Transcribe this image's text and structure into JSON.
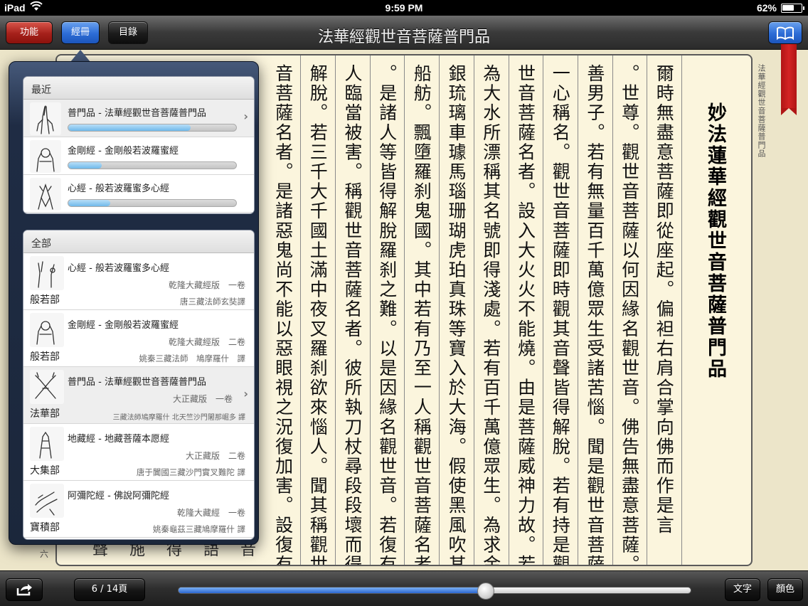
{
  "status_bar": {
    "carrier": "iPad",
    "time": "9:59 PM",
    "battery": "62%",
    "battery_level": 0.62
  },
  "toolbar": {
    "function_label": "功能",
    "sutra_label": "經冊",
    "toc_label": "目錄",
    "title": "法華經觀世音菩薩普門品",
    "bookmark_icon": "open-book-icon"
  },
  "page": {
    "side_label": "法華經觀世音菩薩普門品",
    "heading": "妙法蓮華經觀世音菩薩普門品",
    "columns": [
      "爾時無盡意菩薩即從座起。偏袒右肩合掌向佛而作是言",
      "。世尊。觀世音菩薩以何因緣名觀世音。佛告無盡意菩薩。",
      "善男子。若有無量百千萬億眾生受諸苦惱。聞是觀世音菩薩",
      "一心稱名。觀世音菩薩即時觀其音聲皆得解脫。若有持是觀",
      "世音菩薩名者。設入大火火不能燒。由是菩薩威神力故。若",
      "為大水所漂稱其名號即得淺處。若有百千萬億眾生。為求金",
      "銀琉璃車璩馬瑙珊瑚虎珀真珠等寶入於大海。假使黑風吹其",
      "船舫。飄墮羅刹鬼國。其中若有乃至一人稱觀世音菩薩名者",
      "。是諸人等皆得解脫羅刹之難。以是因緣名觀世音。若復有",
      "人臨當被害。稱觀世音菩薩名者。彼所執刀杖尋段段壞而得",
      "解脫。若三千大千國土滿中夜叉羅刹欲來惱人。聞其稱觀世",
      "音菩薩名者。是諸惡鬼尚不能以惡眼視之況復加害。設復有"
    ],
    "peek_chars": [
      "聲",
      "施",
      "得",
      "語",
      "音"
    ],
    "peek_number": "六"
  },
  "popover": {
    "recent_header": "最近",
    "recent": [
      {
        "title": "普門品 - 法華經觀世音菩薩普門品",
        "progress": 0.73,
        "thumb": "praying-hands-icon"
      },
      {
        "title": "金剛經 - 金剛般若波羅蜜經",
        "progress": 0.2,
        "thumb": "mudra-hands-icon"
      },
      {
        "title": "心經 - 般若波羅蜜多心經",
        "progress": 0.25,
        "thumb": "lotus-hands-icon"
      }
    ],
    "all_header": "全部",
    "all": [
      {
        "title": "心經 - 般若波羅蜜多心經",
        "category": "般若部",
        "edition": "乾隆大藏經版　一卷",
        "translator": "唐三藏法師玄奘譯",
        "thumb": "teaching-hands-icon"
      },
      {
        "title": "金剛經 - 金剛般若波羅蜜經",
        "category": "般若部",
        "edition": "乾隆大藏經版　二卷",
        "translator": "姚秦三藏法師　鳩摩羅什　譯",
        "thumb": "mudra-hands-icon"
      },
      {
        "title": "普門品 - 法華經觀世音菩薩普門品",
        "category": "法華部",
        "edition": "大正藏版　一卷",
        "translator": "三藏法師鳩摩羅什 北天竺沙門闍那崛多 譯",
        "thumb": "crossed-hands-icon"
      },
      {
        "title": "地藏經 - 地藏菩薩本愿經",
        "category": "大集部",
        "edition": "大正藏版　二卷",
        "translator": "唐于闐國三藏沙門實叉難陀 譯",
        "thumb": "joined-hands-icon"
      },
      {
        "title": "阿彌陀經 - 佛說阿彌陀經",
        "category": "寶積部",
        "edition": "乾隆大藏經　一卷",
        "translator": "姚秦龜茲三藏鳩摩羅什 譯",
        "thumb": "offering-hands-icon"
      }
    ]
  },
  "bottom_bar": {
    "share_icon": "share-icon",
    "page_indicator": "6 / 14頁",
    "slider_value": 0.6,
    "text_label": "文字",
    "color_label": "顏色"
  },
  "colors": {
    "accent_blue": "#2c6cd6",
    "accent_red": "#a5201a",
    "paper": "#fbf5dd",
    "ribbon": "#c41c1c"
  }
}
